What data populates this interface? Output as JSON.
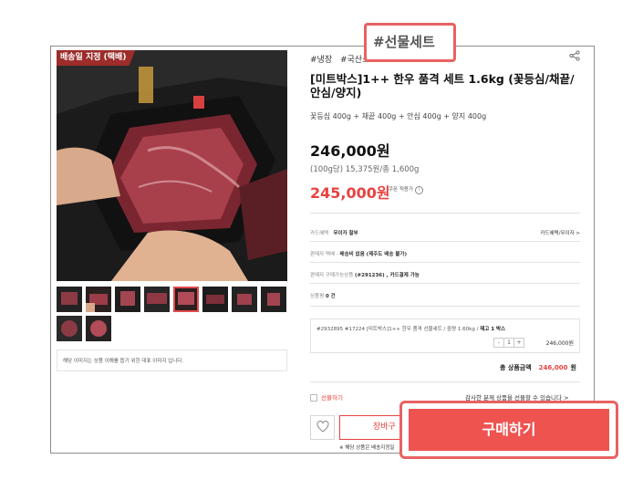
{
  "product": {
    "ribbon": "배송일 지정 (택배)",
    "tags": [
      "#냉장",
      "#국산소"
    ],
    "highlight_tag": "#선물세트",
    "title": "[미트박스]1++ 한우 품격 세트 1.6kg (꽃등심/채끝/안심/양지)",
    "subtitle": "꽃등심 400g + 채끝 400g + 안심 400g + 양지 400g",
    "price": "246,000원",
    "unit_price": "(100g당) 15,375원/총 1,600g",
    "sale_price": "245,000원",
    "coupon_label": "쿠폰 적용가",
    "info_icon": "i"
  },
  "info_rows": {
    "card": {
      "label": "카드혜택",
      "value": "무이자 할부",
      "link": "카드혜택/무이자 >"
    },
    "shipping": {
      "label": "판매자 택배",
      "value": "배송비 없음 (제주도 배송 불가)"
    },
    "seller": {
      "label": "판매자 구매가능상품",
      "value": "(#291236) , 카드결제 가능"
    },
    "reviews": {
      "label": "상품평",
      "value": "0 건"
    }
  },
  "option": {
    "text": "#2932895  #17224  [미트박스]1++ 한우 품격 선물세트 / 중량 1.60kg / ",
    "stock": "재고 1 박스",
    "minus": "-",
    "qty": "1",
    "plus": "+",
    "price": "246,000원"
  },
  "total": {
    "label": "총 상품금액",
    "amount": "246,000",
    "unit": "원"
  },
  "gift": {
    "label": "선물하기",
    "link": "감사한 분께 상품을 선물할 수 있습니다 >"
  },
  "buttons": {
    "cart": "장바구",
    "buy": "구매하기",
    "heart_icon": "heart-icon"
  },
  "footnote": "※ 해당 상품은 배송지정일",
  "gallery_notice": "해당 이미지는 상품 이해를 돕기 위한 대표 이미지 입니다.",
  "colors": {
    "accent": "#e8423f",
    "callout": "#e86262",
    "ribbon": "#9c2d2b"
  }
}
